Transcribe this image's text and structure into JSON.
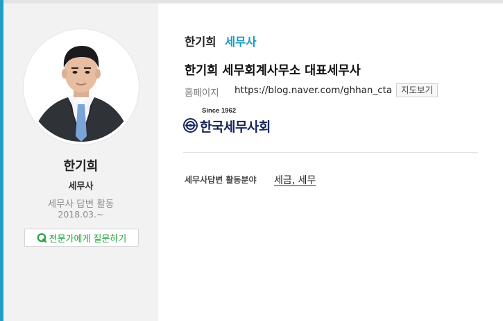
{
  "profile": {
    "name": "한기희",
    "role": "세무사",
    "activity": "세무사 답변 활동",
    "since": "2018.03.~",
    "ask_button": "전문가에게 질문하기"
  },
  "main": {
    "name": "한기희",
    "badge": "세무사",
    "title": "한기희 세무회계사무소 대표세무사",
    "homepage_label": "홈페이지",
    "homepage_url": "https://blog.naver.com/ghhan_cta",
    "map_button": "지도보기",
    "association_logo": {
      "since": "Since 1962",
      "name": "한국세무사회"
    },
    "field_label": "세무사답변 활동분야",
    "field_value": "세금, 세무"
  },
  "colors": {
    "accent": "#1a9cc2",
    "ask_green": "#1fa33a",
    "logo_navy": "#13245a"
  },
  "icons": {
    "ask": "speech-bubble-icon",
    "logo_emblem": "association-emblem-icon"
  }
}
